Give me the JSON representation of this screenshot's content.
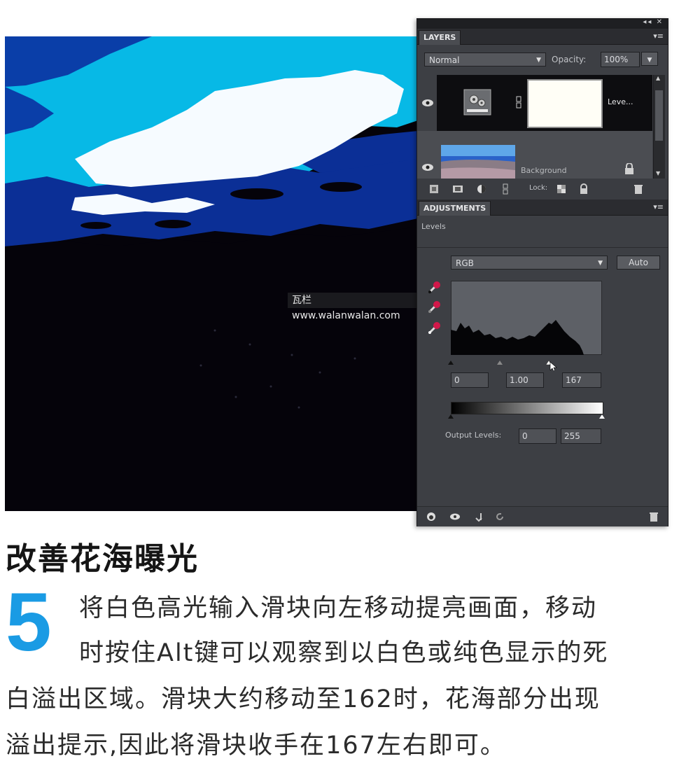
{
  "watermark": "瓦栏 www.walanwalan.com",
  "layers_panel": {
    "tab_label": "LAYERS",
    "blend_mode": "Normal",
    "opacity_label": "Opacity:",
    "opacity_value": "100%",
    "layers": [
      {
        "name": "Leve...",
        "visible": true
      },
      {
        "name": "Background",
        "visible": true
      }
    ],
    "lock_label": "Lock:"
  },
  "adjustments_panel": {
    "tab_label": "ADJUSTMENTS",
    "adjustment_name": "Levels",
    "channel": "RGB",
    "auto_label": "Auto",
    "input_black": "0",
    "input_gamma": "1.00",
    "input_white": "167",
    "output_label": "Output Levels:",
    "output_black": "0",
    "output_white": "255"
  },
  "article": {
    "heading": "改善花海曝光",
    "step_number": "5",
    "lines": [
      "将白色高光输入滑块向左移动提亮画面，移动",
      "时按住Alt键可以观察到以白色或纯色显示的死",
      "白溢出区域。滑块大约移动至162时，花海部分出现",
      "溢出提示,因此将滑块收手在167左右即可。"
    ]
  },
  "colors": {
    "accent_blue": "#1a9be4",
    "panel_bg": "#3d3f44",
    "sky_cyan": "#07b9e6",
    "sky_blue": "#0a3ea8",
    "cloud_white": "#f6fbff"
  }
}
